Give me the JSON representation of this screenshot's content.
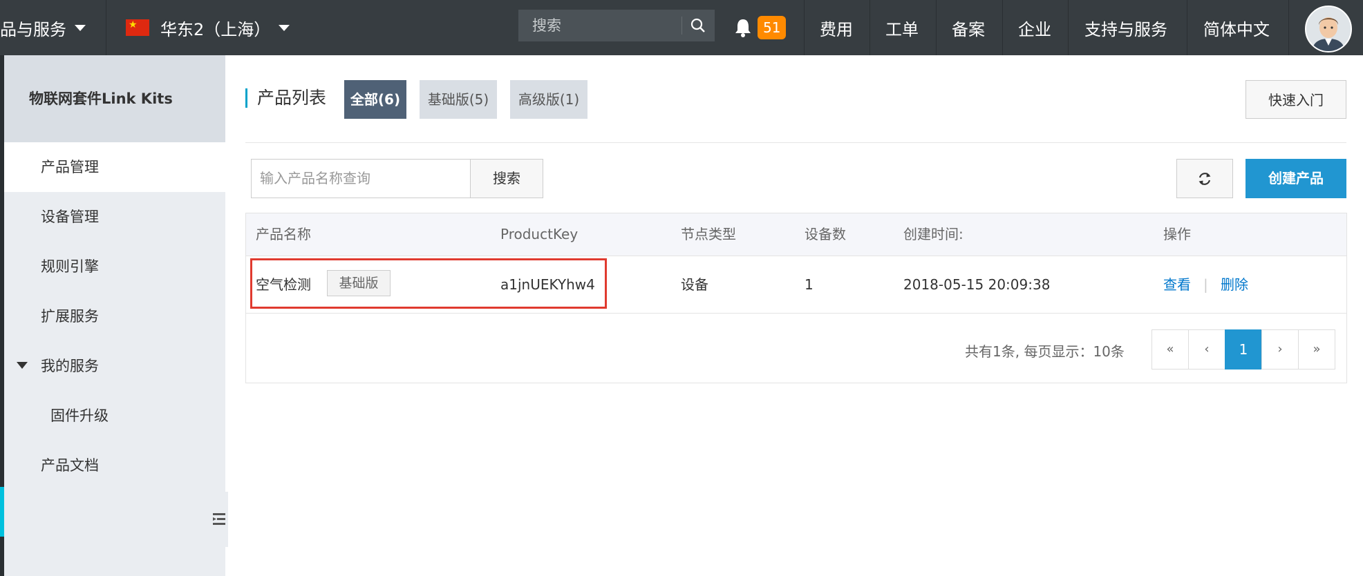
{
  "topbar": {
    "products_menu": "品与服务",
    "region": "华东2（上海）",
    "search_placeholder": "搜索",
    "notification_count": "51",
    "nav": [
      "费用",
      "工单",
      "备案",
      "企业",
      "支持与服务",
      "简体中文"
    ]
  },
  "sidebar": {
    "title": "物联网套件Link Kits",
    "items": [
      {
        "label": "产品管理",
        "active": true
      },
      {
        "label": "设备管理"
      },
      {
        "label": "规则引擎"
      },
      {
        "label": "扩展服务"
      },
      {
        "label": "我的服务"
      },
      {
        "label": "固件升级"
      },
      {
        "label": "产品文档"
      }
    ]
  },
  "main": {
    "header_title": "产品列表",
    "tabs": [
      "全部(6)",
      "基础版(5)",
      "高级版(1)"
    ],
    "quick_start": "快速入门",
    "query_placeholder": "输入产品名称查询",
    "search_button": "搜索",
    "create_button": "创建产品",
    "table": {
      "headers": [
        "产品名称",
        "ProductKey",
        "节点类型",
        "设备数",
        "创建时间:",
        "操作"
      ],
      "rows": [
        {
          "name": "空气检测",
          "tag": "基础版",
          "product_key": "a1jnUEKYhw4",
          "node_type": "设备",
          "device_count": "1",
          "created": "2018-05-15 20:09:38",
          "action_view": "查看",
          "action_sep": "|",
          "action_delete": "删除"
        }
      ]
    },
    "pagination": {
      "info": "共有1条, 每页显示：10条",
      "first": "«",
      "prev": "‹",
      "current": "1",
      "next": "›",
      "last": "»"
    }
  },
  "colors": {
    "topbar": "#373d41",
    "primary": "#2196d1",
    "highlight": "#e03a2f",
    "badge": "#ff8a00"
  }
}
